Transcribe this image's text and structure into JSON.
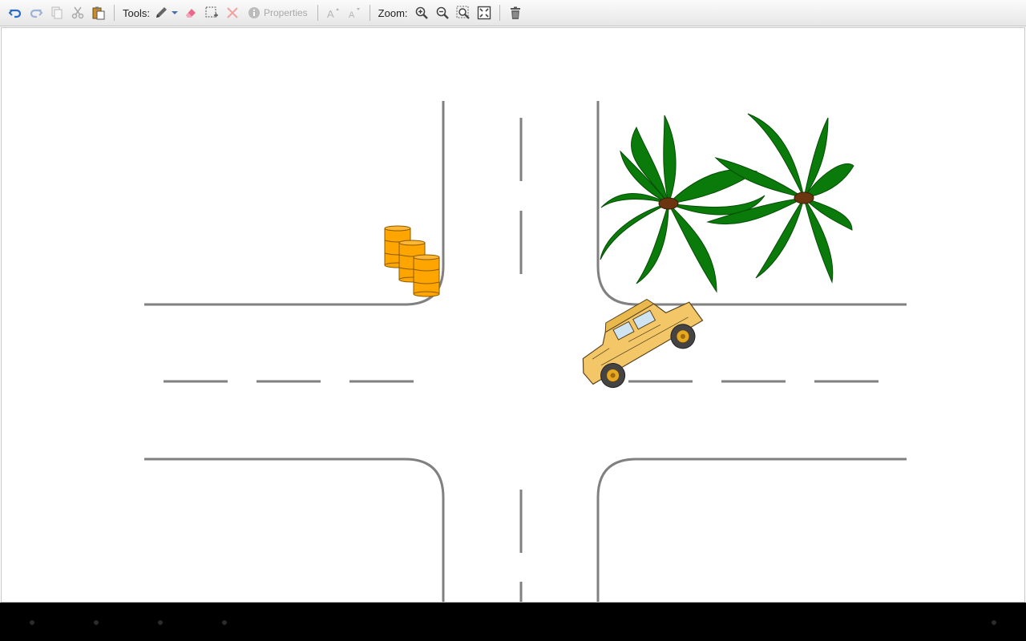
{
  "toolbar": {
    "tools_label": "Tools:",
    "zoom_label": "Zoom:",
    "properties_label": "Properties",
    "buttons": {
      "undo": "undo-icon",
      "redo": "redo-icon",
      "copy": "copy-icon",
      "cut": "scissors-icon",
      "paste": "paste-icon",
      "pen": "pencil-icon",
      "eraser": "eraser-icon",
      "select": "marquee-select-icon",
      "delete": "x-icon",
      "properties": "info-icon",
      "font_larger": "font-increase-icon",
      "font_smaller": "font-decrease-icon",
      "zoom_in": "zoom-in-icon",
      "zoom_out": "zoom-out-icon",
      "zoom_selection": "zoom-selection-icon",
      "zoom_fit": "zoom-fit-icon",
      "trash": "trash-icon"
    },
    "colors": {
      "accent": "#2a6bc4",
      "disabled": "#a9a9a9",
      "eraser": "#e8688a"
    }
  },
  "canvas": {
    "objects": [
      "road-intersection",
      "oil-barrels",
      "palm-trees",
      "humvee-vehicle"
    ],
    "colors": {
      "road_line": "#808080",
      "barrel": "#ffa500",
      "tree": "#0a7a0a",
      "trunk": "#7a3a12",
      "vehicle": "#f3c768"
    }
  },
  "system_nav": {
    "icons": [
      "back-icon",
      "home-icon",
      "recents-icon",
      "menu-icon",
      "notification-icon"
    ]
  }
}
